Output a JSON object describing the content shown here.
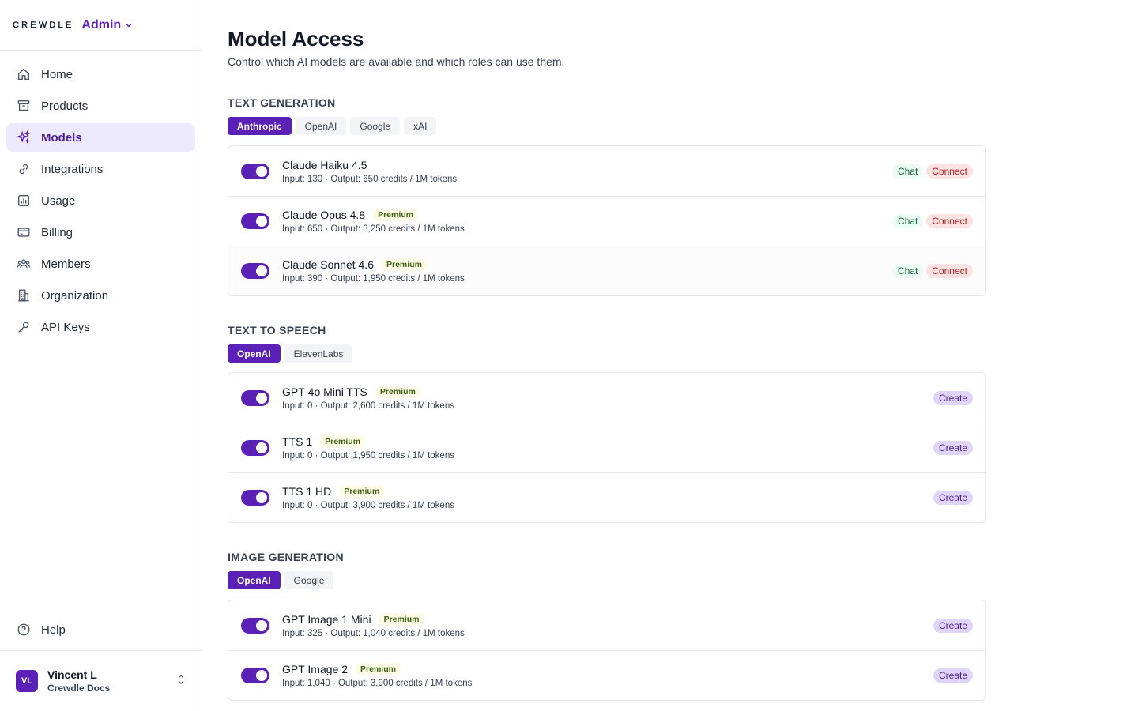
{
  "brand": {
    "logo": "CREWDLE",
    "workspace": "Admin"
  },
  "nav": [
    {
      "label": "Home",
      "icon": "home-icon"
    },
    {
      "label": "Products",
      "icon": "archive-box-icon"
    },
    {
      "label": "Models",
      "icon": "sparkles-icon",
      "active": true
    },
    {
      "label": "Integrations",
      "icon": "link-icon"
    },
    {
      "label": "Usage",
      "icon": "bar-chart-icon"
    },
    {
      "label": "Billing",
      "icon": "credit-card-icon"
    },
    {
      "label": "Members",
      "icon": "users-icon"
    },
    {
      "label": "Organization",
      "icon": "building-icon"
    },
    {
      "label": "API Keys",
      "icon": "key-icon"
    }
  ],
  "help": {
    "label": "Help",
    "icon": "question-circle-icon"
  },
  "user": {
    "initials": "VL",
    "name": "Vincent L",
    "org": "Crewdle Docs"
  },
  "page": {
    "title": "Model Access",
    "subtitle": "Control which AI models are available and which roles can use them."
  },
  "sections": {
    "text_generation": {
      "title": "TEXT GENERATION",
      "tabs": [
        "Anthropic",
        "OpenAI",
        "Google",
        "xAI"
      ],
      "active_tab": "Anthropic",
      "models": [
        {
          "name": "Claude Haiku 4.5",
          "premium": "",
          "pricing": "Input: 130 · Output: 650 credits / 1M tokens",
          "badges": [
            "Chat",
            "Connect"
          ],
          "enabled": true
        },
        {
          "name": "Claude Opus 4.8",
          "premium": "Premium",
          "pricing": "Input: 650 · Output: 3,250 credits / 1M tokens",
          "badges": [
            "Chat",
            "Connect"
          ],
          "enabled": true
        },
        {
          "name": "Claude Sonnet 4.6",
          "premium": "Premium",
          "pricing": "Input: 390 · Output: 1,950 credits / 1M tokens",
          "badges": [
            "Chat",
            "Connect"
          ],
          "enabled": true
        }
      ]
    },
    "text_to_speech": {
      "title": "TEXT TO SPEECH",
      "tabs": [
        "OpenAI",
        "ElevenLabs"
      ],
      "active_tab": "OpenAI",
      "models": [
        {
          "name": "GPT-4o Mini TTS",
          "premium": "Premium",
          "pricing": "Input: 0 · Output: 2,600 credits / 1M tokens",
          "badges": [
            "Create"
          ],
          "enabled": true
        },
        {
          "name": "TTS 1",
          "premium": "Premium",
          "pricing": "Input: 0 · Output: 1,950 credits / 1M tokens",
          "badges": [
            "Create"
          ],
          "enabled": true
        },
        {
          "name": "TTS 1 HD",
          "premium": "Premium",
          "pricing": "Input: 0 · Output: 3,900 credits / 1M tokens",
          "badges": [
            "Create"
          ],
          "enabled": true
        }
      ]
    },
    "image_generation": {
      "title": "IMAGE GENERATION",
      "tabs": [
        "OpenAI",
        "Google"
      ],
      "active_tab": "OpenAI",
      "models": [
        {
          "name": "GPT Image 1 Mini",
          "premium": "Premium",
          "pricing": "Input: 325 · Output: 1,040 credits / 1M tokens",
          "badges": [
            "Create"
          ],
          "enabled": true
        },
        {
          "name": "GPT Image 2",
          "premium": "Premium",
          "pricing": "Input: 1,040 · Output: 3,900 credits / 1M tokens",
          "badges": [
            "Create"
          ],
          "enabled": true
        }
      ]
    }
  },
  "colors": {
    "accent": "#5b21b6",
    "active_nav_bg": "#ede9fe",
    "premium_bg": "#fefce8",
    "chat_bg": "#ecfdf5",
    "connect_bg": "#fee2e2",
    "create_bg": "#e0d4fb"
  }
}
